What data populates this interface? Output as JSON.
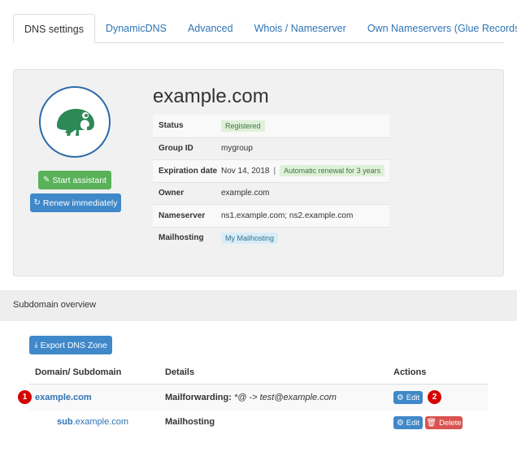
{
  "tabs": [
    {
      "label": "DNS settings",
      "active": true
    },
    {
      "label": "DynamicDNS",
      "active": false
    },
    {
      "label": "Advanced",
      "active": false
    },
    {
      "label": "Whois / Nameserver",
      "active": false
    },
    {
      "label": "Own Nameservers (Glue Records)",
      "active": false
    }
  ],
  "domain": {
    "name": "example.com",
    "start_assistant_label": "Start assistant",
    "renew_label": "Renew immediately",
    "info": {
      "status_label": "Status",
      "status_value": "Registered",
      "group_label": "Group ID",
      "group_value": "mygroup",
      "expiration_label": "Expiration date",
      "expiration_value": "Nov 14, 2018",
      "expiration_sep": "|",
      "renewal_badge": "Automatic renewal for 3 years",
      "owner_label": "Owner",
      "owner_value": "example.com",
      "nameserver_label": "Nameserver",
      "nameserver_value": "ns1.example.com; ns2.example.com",
      "mailhosting_label": "Mailhosting",
      "mailhosting_badge": "My Mailhosting"
    }
  },
  "subdomains": {
    "section_title": "Subdomain overview",
    "export_label": "Export DNS Zone",
    "headers": {
      "domain": "Domain/ Subdomain",
      "details": "Details",
      "actions": "Actions"
    },
    "rows": [
      {
        "domain": "example.com",
        "details_label": "Mailforwarding:",
        "details_value": "*@ -> test@example.com",
        "edit_label": "Edit"
      },
      {
        "sub_prefix": "sub",
        "domain_suffix": ".example.com",
        "details_label": "Mailhosting",
        "edit_label": "Edit",
        "delete_label": "Delete"
      }
    ]
  },
  "markers": [
    "1",
    "2"
  ],
  "colors": {
    "link": "#2f74b5",
    "green_button": "#59b259",
    "blue_button": "#3f88c9",
    "red_button": "#d9534f",
    "marker": "#d40000",
    "logo": "#2d8a57"
  },
  "icons": [
    "chameleon-logo-icon",
    "wand-icon",
    "refresh-icon",
    "download-icon",
    "gear-icon",
    "trash-icon"
  ]
}
